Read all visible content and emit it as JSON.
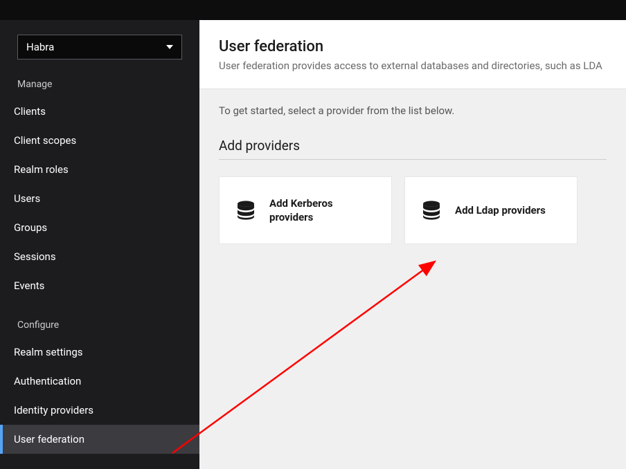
{
  "realm": {
    "selected": "Habra"
  },
  "sidebar": {
    "manage_header": "Manage",
    "configure_header": "Configure",
    "manage_items": [
      {
        "label": "Clients"
      },
      {
        "label": "Client scopes"
      },
      {
        "label": "Realm roles"
      },
      {
        "label": "Users"
      },
      {
        "label": "Groups"
      },
      {
        "label": "Sessions"
      },
      {
        "label": "Events"
      }
    ],
    "configure_items": [
      {
        "label": "Realm settings"
      },
      {
        "label": "Authentication"
      },
      {
        "label": "Identity providers"
      },
      {
        "label": "User federation"
      }
    ]
  },
  "page": {
    "title": "User federation",
    "description": "User federation provides access to external databases and directories, such as LDA",
    "instruction": "To get started, select a provider from the list below.",
    "add_providers_title": "Add providers"
  },
  "providers": [
    {
      "label": "Add Kerberos providers",
      "icon": "database-icon"
    },
    {
      "label": "Add Ldap providers",
      "icon": "database-icon"
    }
  ]
}
